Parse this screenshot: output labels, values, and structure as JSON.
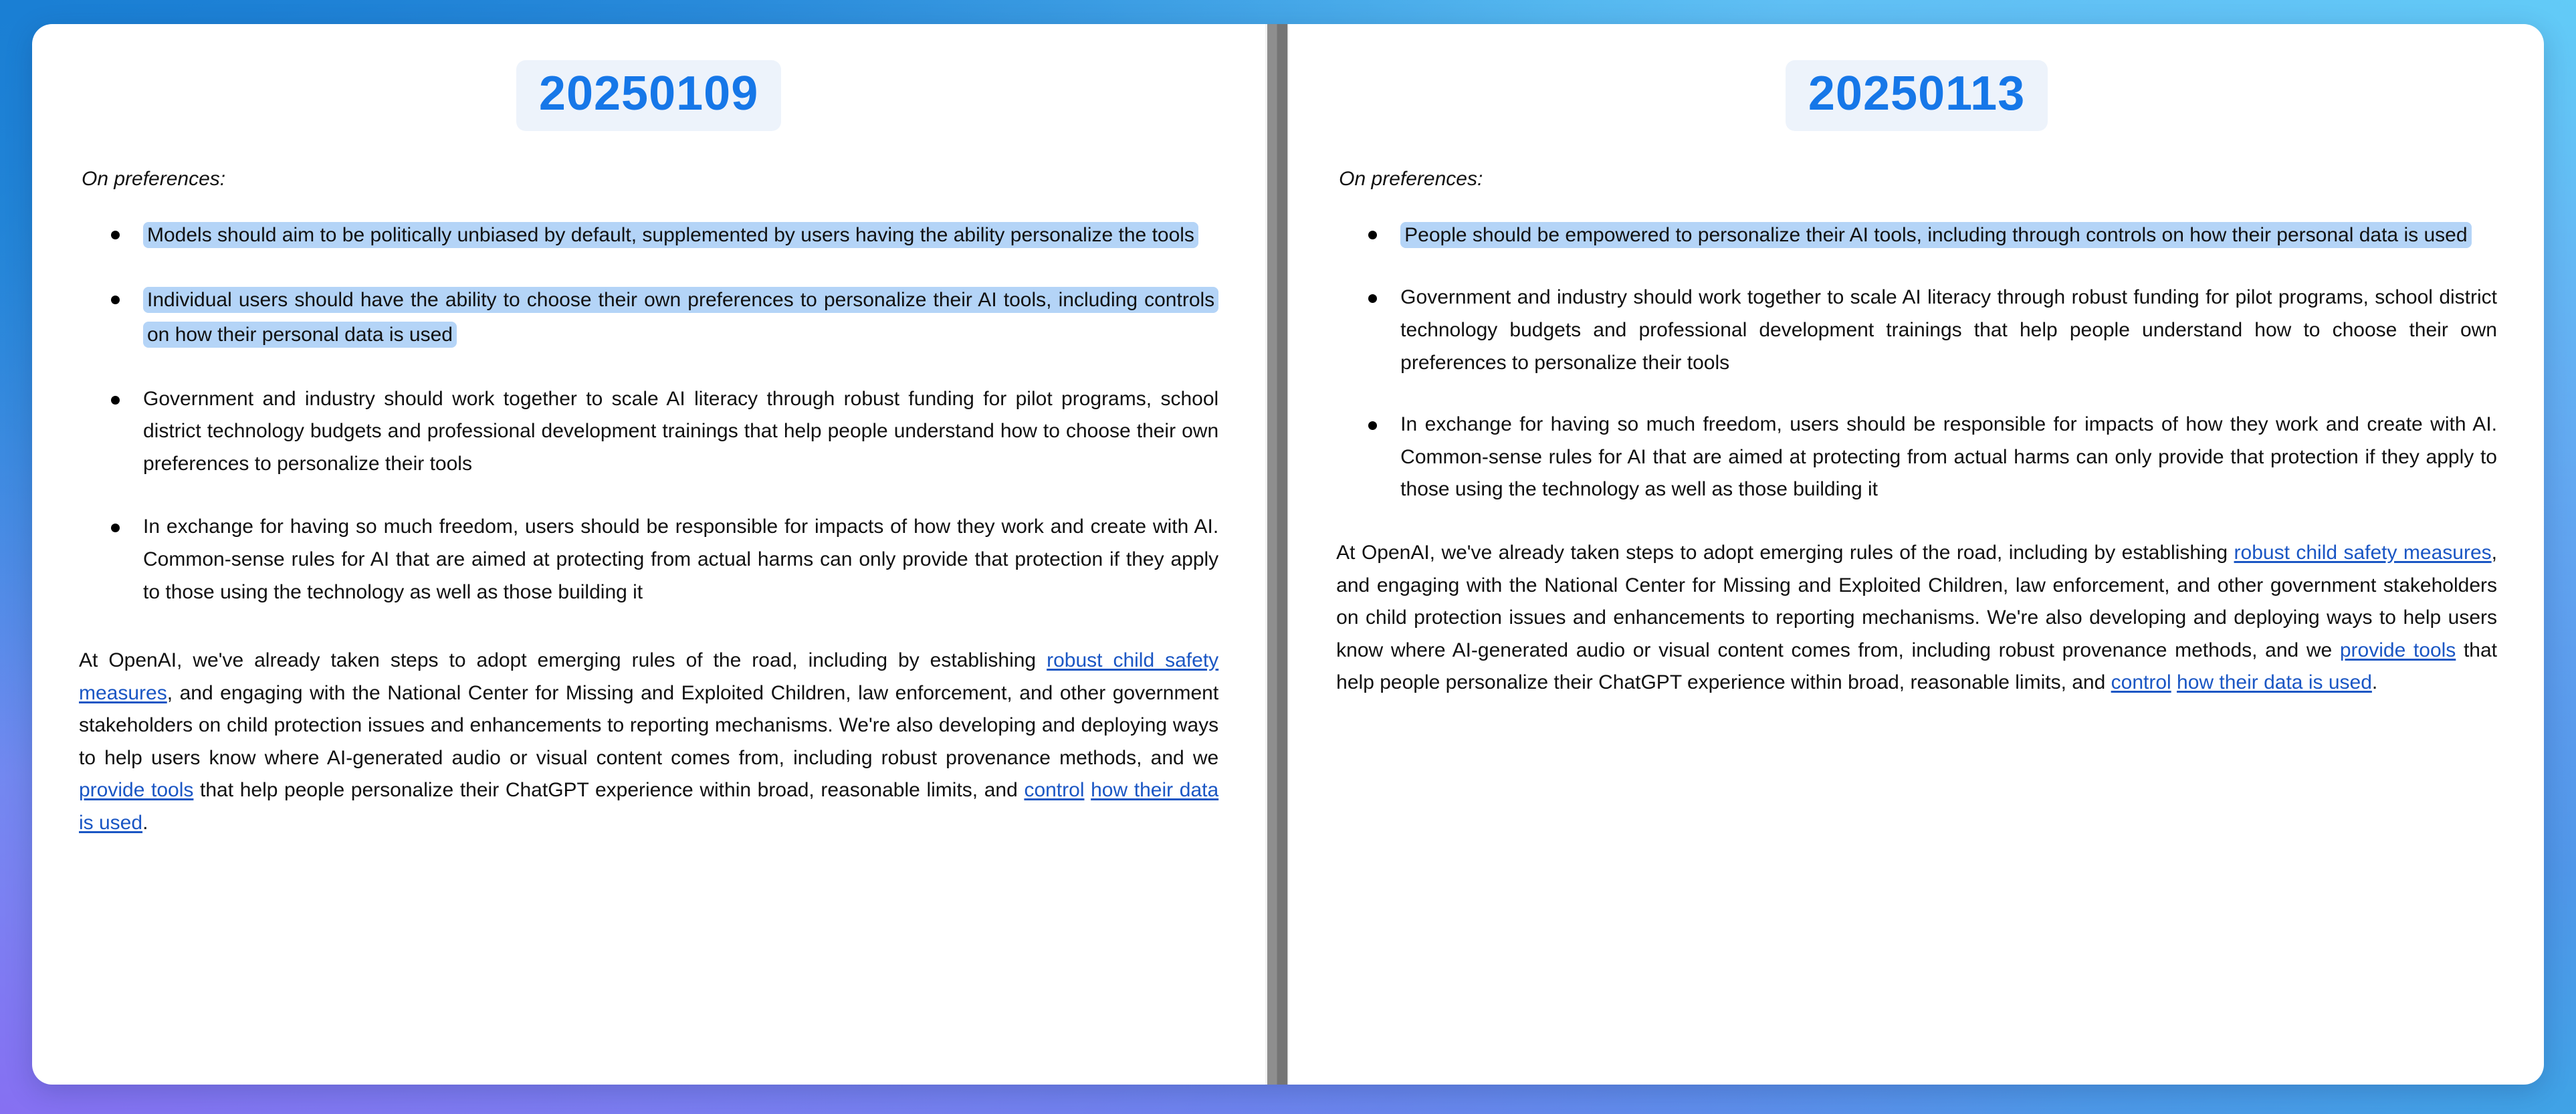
{
  "theme": {
    "accent_blue": "#1677e8",
    "badge_bg": "#edf3fb",
    "highlight_bg": "#b4d4f7",
    "link_color": "#1a56c4",
    "divider_gray": "#757575",
    "card_bg": "#ffffff",
    "bg_top_left": "#1a7fd4",
    "bg_top_right": "#62cbf7",
    "bg_bottom_left": "#8670f2",
    "bg_bottom_right": "#3fa3e6"
  },
  "panels": {
    "left": {
      "date_badge": "20250109",
      "section_label": "On preferences:",
      "bullets": [
        {
          "highlighted": true,
          "text": "Models should aim to be politically unbiased by default, supplemented by users having the ability personalize the tools"
        },
        {
          "highlighted": true,
          "text": "Individual users should have the ability to choose their own preferences to personalize their AI tools, including controls on how their personal data is used"
        },
        {
          "highlighted": false,
          "text": "Government and industry should work together to scale AI literacy through robust funding for pilot programs, school district technology budgets and professional development trainings that help people understand how to choose their own preferences to personalize their tools"
        },
        {
          "highlighted": false,
          "text": "In exchange for having so much freedom, users should be responsible for impacts of how they work and create with AI. Common-sense rules for AI that are aimed at protecting from actual harms can only provide that protection if they apply to those using the technology as well as those building it"
        }
      ],
      "paragraph": {
        "part1": "At OpenAI, we've already taken steps to adopt emerging rules of the road, including by establishing ",
        "link1": "robust child safety measures",
        "part2": ", and engaging with the National Center for Missing and Exploited Children, law enforcement, and other government stakeholders on child protection issues and enhancements to reporting mechanisms. We're also developing and deploying ways to help users know where AI-generated audio or visual content comes from, including robust provenance methods, and we ",
        "link2": "provide tools",
        "part3": " that help people personalize their ChatGPT experience within broad, reasonable limits, and ",
        "link3": "control",
        "part4": " ",
        "link4": "how their data is used",
        "part5": "."
      }
    },
    "right": {
      "date_badge": "20250113",
      "section_label": "On preferences:",
      "bullets": [
        {
          "highlighted": true,
          "text": "People should be empowered to personalize their AI tools, including through controls on how their personal data is used"
        },
        {
          "highlighted": false,
          "text": "Government and industry should work together to scale AI literacy through robust funding for pilot programs, school district technology budgets and professional development trainings that help people understand how to choose their own preferences to personalize their tools"
        },
        {
          "highlighted": false,
          "text": "In exchange for having so much freedom, users should be responsible for impacts of how they work and create with AI. Common-sense rules for AI that are aimed at protecting from actual harms can only provide that protection if they apply to those using the technology as well as those building it"
        }
      ],
      "paragraph": {
        "part1": "At OpenAI, we've already taken steps to adopt emerging rules of the road, including by establishing ",
        "link1": "robust child safety measures",
        "part2": ", and engaging with the National Center for Missing and Exploited Children, law enforcement, and other government stakeholders on child protection issues and enhancements to reporting mechanisms. We're also developing and deploying ways to help users know where AI-generated audio or visual content comes from, including robust provenance methods, and we ",
        "link2": "provide tools",
        "part3": " that help people personalize their ChatGPT experience within broad, reasonable limits, and ",
        "link3": "control",
        "part4": " ",
        "link4": "how their data is used",
        "part5": "."
      }
    }
  }
}
